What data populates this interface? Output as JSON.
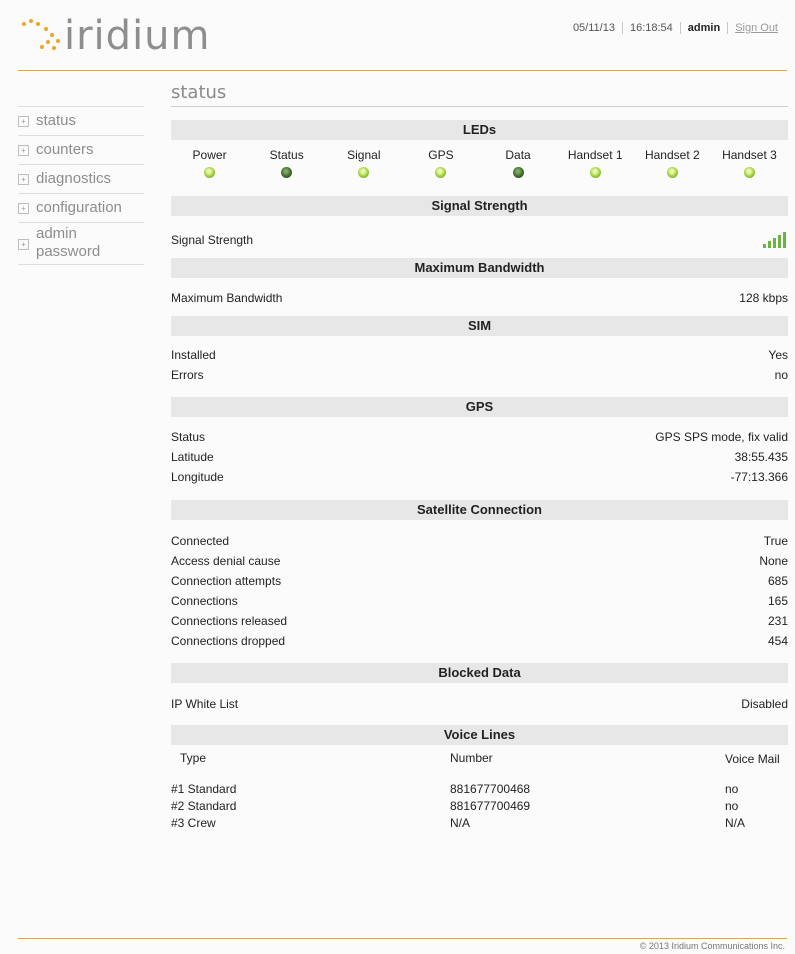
{
  "header": {
    "logo_text": "iridium",
    "date": "05/11/13",
    "time": "16:18:54",
    "user": "admin",
    "sign_out": "Sign Out"
  },
  "sidebar": {
    "items": [
      {
        "label": "status"
      },
      {
        "label": "counters"
      },
      {
        "label": "diagnostics"
      },
      {
        "label": "configuration"
      },
      {
        "label": "admin password"
      }
    ]
  },
  "main": {
    "title": "status",
    "leds": {
      "heading": "LEDs",
      "items": [
        {
          "label": "Power",
          "state": "green"
        },
        {
          "label": "Status",
          "state": "dark"
        },
        {
          "label": "Signal",
          "state": "green"
        },
        {
          "label": "GPS",
          "state": "green"
        },
        {
          "label": "Data",
          "state": "dark"
        },
        {
          "label": "Handset 1",
          "state": "green"
        },
        {
          "label": "Handset 2",
          "state": "green"
        },
        {
          "label": "Handset 3",
          "state": "green"
        }
      ]
    },
    "signal": {
      "heading": "Signal Strength",
      "label": "Signal Strength",
      "bars_level": 5,
      "bars_max": 5
    },
    "bandwidth": {
      "heading": "Maximum Bandwidth",
      "label": "Maximum Bandwidth",
      "value": "128 kbps"
    },
    "sim": {
      "heading": "SIM",
      "rows": [
        {
          "label": "Installed",
          "value": "Yes"
        },
        {
          "label": "Errors",
          "value": "no"
        }
      ]
    },
    "gps": {
      "heading": "GPS",
      "rows": [
        {
          "label": "Status",
          "value": "GPS SPS mode, fix valid"
        },
        {
          "label": "Latitude",
          "value": "38:55.435"
        },
        {
          "label": "Longitude",
          "value": "-77:13.366"
        }
      ]
    },
    "satellite": {
      "heading": "Satellite Connection",
      "rows": [
        {
          "label": "Connected",
          "value": "True"
        },
        {
          "label": "Access denial cause",
          "value": "None"
        },
        {
          "label": "Connection attempts",
          "value": "685"
        },
        {
          "label": "Connections",
          "value": "165"
        },
        {
          "label": "Connections released",
          "value": "231"
        },
        {
          "label": "Connections dropped",
          "value": "454"
        }
      ]
    },
    "blocked": {
      "heading": "Blocked Data",
      "label": "IP White List",
      "value": "Disabled"
    },
    "voice": {
      "heading": "Voice Lines",
      "columns": [
        "Type",
        "Number",
        "Voice Mail"
      ],
      "rows": [
        {
          "type": "#1  Standard",
          "number": "881677700468",
          "voicemail": "no"
        },
        {
          "type": "#2  Standard",
          "number": "881677700469",
          "voicemail": "no"
        },
        {
          "type": "#3  Crew",
          "number": "N/A",
          "voicemail": "N/A"
        }
      ]
    }
  },
  "footer": {
    "copyright": "© 2013 Iridium Communications Inc."
  },
  "colors": {
    "accent": "#f0a623",
    "led_green": "#9ccf3a",
    "led_dark": "#2f5a22",
    "signal_bars": "#6db33f",
    "section_bg": "#e7e7e7"
  }
}
